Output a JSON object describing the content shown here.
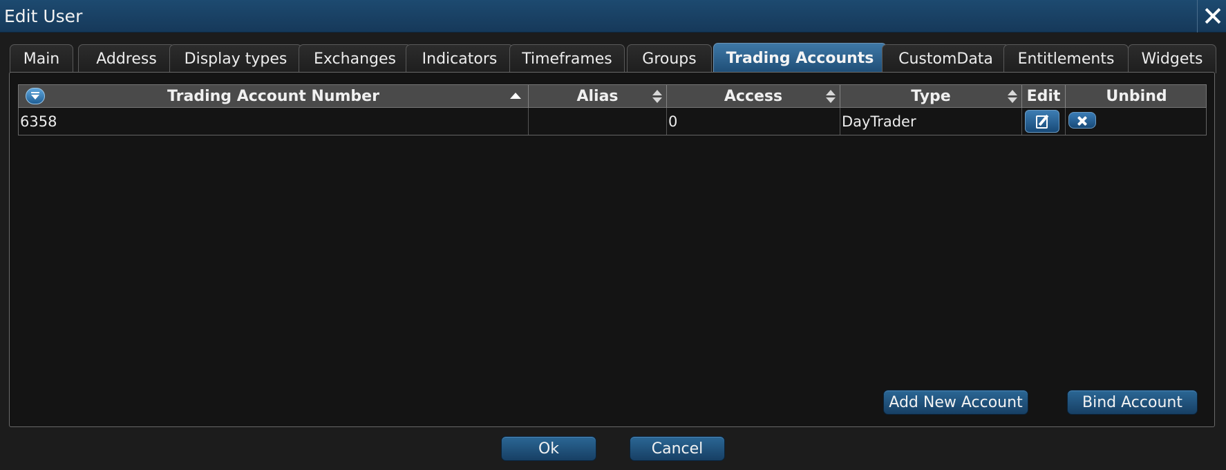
{
  "window": {
    "title": "Edit User"
  },
  "tabs": [
    {
      "label": "Main",
      "active": false
    },
    {
      "label": "Address",
      "active": false
    },
    {
      "label": "Display types",
      "active": false
    },
    {
      "label": "Exchanges",
      "active": false
    },
    {
      "label": "Indicators",
      "active": false
    },
    {
      "label": "Timeframes",
      "active": false
    },
    {
      "label": "Groups",
      "active": false
    },
    {
      "label": "Trading Accounts",
      "active": true
    },
    {
      "label": "CustomData",
      "active": false
    },
    {
      "label": "Entitlements",
      "active": false
    },
    {
      "label": "Widgets",
      "active": false
    }
  ],
  "grid": {
    "columns": [
      {
        "label": "Trading Account Number",
        "sort": "ascending"
      },
      {
        "label": "Alias",
        "sort": "none"
      },
      {
        "label": "Access",
        "sort": "none"
      },
      {
        "label": "Type",
        "sort": "none"
      },
      {
        "label": "Edit"
      },
      {
        "label": "Unbind"
      }
    ],
    "rows": [
      {
        "account_number": "6358",
        "alias": "",
        "access": "0",
        "type": "DayTrader"
      }
    ]
  },
  "panel_buttons": {
    "add_new_account": "Add New Account",
    "bind_account": "Bind Account"
  },
  "footer": {
    "ok": "Ok",
    "cancel": "Cancel"
  },
  "colors": {
    "accent": "#1e4d75",
    "titlebar": "#1a4466",
    "background": "#141414"
  },
  "icons": {
    "close": "close-icon",
    "filter": "filter-dropdown-icon",
    "edit": "edit-pencil-icon",
    "unbind": "x-icon"
  }
}
